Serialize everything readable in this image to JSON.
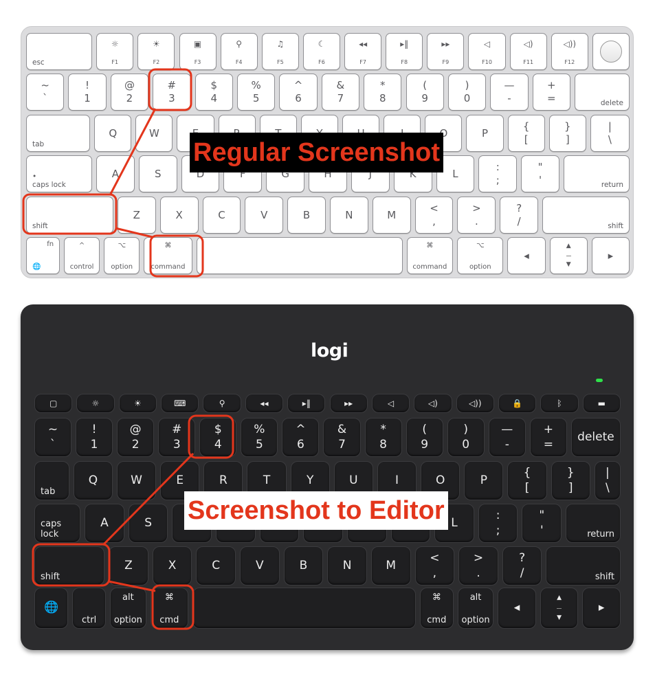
{
  "annotation_color": "#e3361c",
  "labels": {
    "regular": "Regular Screenshot",
    "editor": "Screenshot to Editor"
  },
  "apple": {
    "fn_row": {
      "esc": "esc",
      "keys": [
        {
          "icon": "brightness-down-icon",
          "label": "F1"
        },
        {
          "icon": "brightness-up-icon",
          "label": "F2"
        },
        {
          "icon": "mission-control-icon",
          "label": "F3"
        },
        {
          "icon": "search-icon",
          "label": "F4"
        },
        {
          "icon": "microphone-icon",
          "label": "F5"
        },
        {
          "icon": "moon-icon",
          "label": "F6"
        },
        {
          "icon": "rewind-icon",
          "label": "F7"
        },
        {
          "icon": "play-pause-icon",
          "label": "F8"
        },
        {
          "icon": "fast-forward-icon",
          "label": "F9"
        },
        {
          "icon": "mute-icon",
          "label": "F10"
        },
        {
          "icon": "volume-down-icon",
          "label": "F11"
        },
        {
          "icon": "volume-up-icon",
          "label": "F12"
        }
      ],
      "touch_id": "touch-id-icon"
    },
    "rows": [
      [
        [
          "~",
          "`"
        ],
        [
          "!",
          "1"
        ],
        [
          "@",
          "2"
        ],
        [
          "#",
          "3"
        ],
        [
          "$",
          "4"
        ],
        [
          "%",
          "5"
        ],
        [
          "^",
          "6"
        ],
        [
          "&",
          "7"
        ],
        [
          "*",
          "8"
        ],
        [
          "(",
          "9"
        ],
        [
          ")",
          "0"
        ],
        [
          "—",
          "-"
        ],
        [
          "+",
          "="
        ],
        [
          "delete"
        ]
      ],
      [
        [
          "tab"
        ],
        [
          "Q"
        ],
        [
          "W"
        ],
        [
          "E"
        ],
        [
          "R"
        ],
        [
          "T"
        ],
        [
          "Y"
        ],
        [
          "U"
        ],
        [
          "I"
        ],
        [
          "O"
        ],
        [
          "P"
        ],
        [
          "{",
          "["
        ],
        [
          "}",
          "]"
        ],
        [
          "|",
          "\\"
        ]
      ],
      [
        [
          "•",
          "caps lock"
        ],
        [
          "A"
        ],
        [
          "S"
        ],
        [
          "D"
        ],
        [
          "F"
        ],
        [
          "G"
        ],
        [
          "H"
        ],
        [
          "J"
        ],
        [
          "K"
        ],
        [
          "L"
        ],
        [
          ":",
          ";"
        ],
        [
          "\"",
          "'"
        ],
        [
          "return"
        ]
      ],
      [
        [
          "shift"
        ],
        [
          "Z"
        ],
        [
          "X"
        ],
        [
          "C"
        ],
        [
          "V"
        ],
        [
          "B"
        ],
        [
          "N"
        ],
        [
          "M"
        ],
        [
          "<",
          ","
        ],
        [
          ">",
          "."
        ],
        [
          "?",
          "/"
        ],
        [
          "shift"
        ]
      ],
      [
        [
          "fn",
          "🌐"
        ],
        [
          "^",
          "control"
        ],
        [
          "⌥",
          "option"
        ],
        [
          "⌘",
          "command"
        ],
        [
          ""
        ],
        [
          "⌘",
          "command"
        ],
        [
          "⌥",
          "option"
        ],
        [
          "◂"
        ],
        [
          "▲",
          "▼"
        ],
        [
          "▸"
        ]
      ]
    ],
    "highlighted": [
      "shift",
      "command",
      "3"
    ]
  },
  "logi": {
    "logo": "logi",
    "fn_row": [
      {
        "icon": "home-icon"
      },
      {
        "icon": "brightness-down-icon"
      },
      {
        "icon": "brightness-up-icon"
      },
      {
        "icon": "keyboard-icon"
      },
      {
        "icon": "search-icon"
      },
      {
        "icon": "rewind-icon"
      },
      {
        "icon": "play-pause-icon"
      },
      {
        "icon": "fast-forward-icon"
      },
      {
        "icon": "mute-icon"
      },
      {
        "icon": "volume-down-icon"
      },
      {
        "icon": "volume-up-icon"
      },
      {
        "icon": "lock-icon"
      },
      {
        "icon": "bluetooth-icon"
      },
      {
        "icon": "battery-icon"
      }
    ],
    "rows": [
      [
        [
          "~",
          "`"
        ],
        [
          "!",
          "1"
        ],
        [
          "@",
          "2"
        ],
        [
          "#",
          "3"
        ],
        [
          "$",
          "4"
        ],
        [
          "%",
          "5"
        ],
        [
          "^",
          "6"
        ],
        [
          "&",
          "7"
        ],
        [
          "*",
          "8"
        ],
        [
          "(",
          "9"
        ],
        [
          ")",
          "0"
        ],
        [
          "—",
          "-"
        ],
        [
          "+",
          "="
        ],
        [
          "delete"
        ]
      ],
      [
        [
          "tab"
        ],
        [
          "Q"
        ],
        [
          "W"
        ],
        [
          "E"
        ],
        [
          "R"
        ],
        [
          "T"
        ],
        [
          "Y"
        ],
        [
          "U"
        ],
        [
          "I"
        ],
        [
          "O"
        ],
        [
          "P"
        ],
        [
          "{",
          "["
        ],
        [
          "}",
          "]"
        ],
        [
          "|",
          "\\"
        ]
      ],
      [
        [
          "caps",
          "lock"
        ],
        [
          "A"
        ],
        [
          "S"
        ],
        [
          "D"
        ],
        [
          "F"
        ],
        [
          "G"
        ],
        [
          "H"
        ],
        [
          "J"
        ],
        [
          "K"
        ],
        [
          "L"
        ],
        [
          ":",
          ";"
        ],
        [
          "\"",
          "'"
        ],
        [
          "return"
        ]
      ],
      [
        [
          "shift"
        ],
        [
          "Z"
        ],
        [
          "X"
        ],
        [
          "C"
        ],
        [
          "V"
        ],
        [
          "B"
        ],
        [
          "N"
        ],
        [
          "M"
        ],
        [
          "<",
          ","
        ],
        [
          ">",
          "."
        ],
        [
          "?",
          "/"
        ],
        [
          "shift"
        ]
      ],
      [
        [
          "🌐"
        ],
        [
          "ctrl"
        ],
        [
          "alt",
          "option"
        ],
        [
          "⌘",
          "cmd"
        ],
        [
          ""
        ],
        [
          "⌘",
          "cmd"
        ],
        [
          "alt",
          "option"
        ],
        [
          "◂"
        ],
        [
          "▲",
          "▼"
        ],
        [
          "▸"
        ]
      ]
    ],
    "highlighted": [
      "shift",
      "cmd",
      "4"
    ]
  }
}
